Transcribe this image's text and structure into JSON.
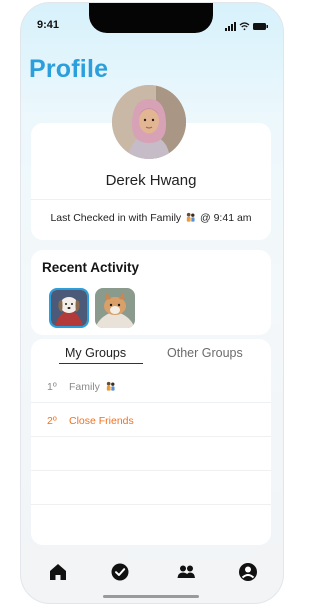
{
  "status_bar": {
    "time": "9:41"
  },
  "header": {
    "title": "Profile"
  },
  "profile": {
    "name": "Derek Hwang",
    "checkin_prefix": "Last Checked in with Family",
    "checkin_suffix": "@ 9:41 am",
    "checkin_icon": "family-emoji-icon"
  },
  "recent_activity": {
    "title": "Recent Activity",
    "items": [
      {
        "icon": "dog-photo"
      },
      {
        "icon": "cat-photo"
      }
    ]
  },
  "groups": {
    "tabs": [
      {
        "label": "My Groups",
        "active": true
      },
      {
        "label": "Other Groups",
        "active": false
      }
    ],
    "rows": [
      {
        "rank": "1º",
        "name": "Family",
        "icon": "family-emoji-icon"
      },
      {
        "rank": "2º",
        "name": "Close Friends"
      }
    ]
  },
  "nav": [
    "home-icon",
    "check-circle-icon",
    "people-icon",
    "profile-icon"
  ],
  "colors": {
    "accent": "#2b9fdb",
    "highlight": "#f0711e"
  }
}
